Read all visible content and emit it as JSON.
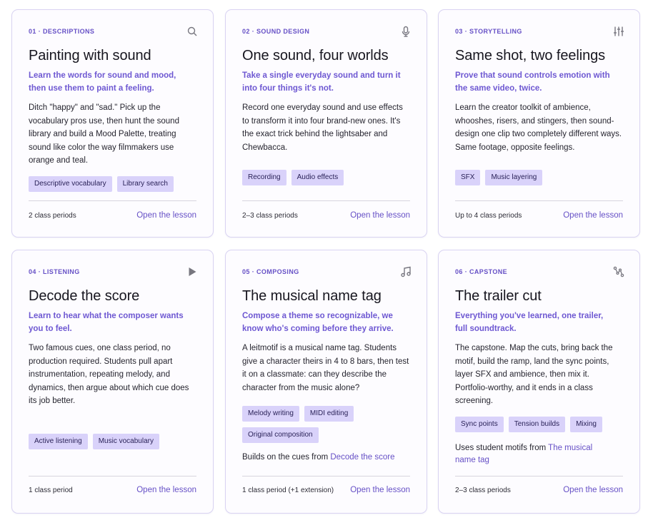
{
  "cards": [
    {
      "eyebrow": "01 · DESCRIPTIONS",
      "icon": "search-icon",
      "title": "Painting with sound",
      "subtitle": "Learn the words for sound and mood, then use them to paint a feeling.",
      "description": "Ditch \"happy\" and \"sad.\" Pick up the vocabulary pros use, then hunt the sound library and build a Mood Palette, treating sound like color the way filmmakers use orange and teal.",
      "tags": [
        "Descriptive vocabulary",
        "Library search"
      ],
      "periods": "2 class periods",
      "link": "Open the lesson"
    },
    {
      "eyebrow": "02 · SOUND DESIGN",
      "icon": "microphone-icon",
      "title": "One sound, four worlds",
      "subtitle": "Take a single everyday sound and turn it into four things it's not.",
      "description": "Record one everyday sound and use effects to transform it into four brand-new ones. It's the exact trick behind the lightsaber and Chewbacca.",
      "tags": [
        "Recording",
        "Audio effects"
      ],
      "periods": "2–3 class periods",
      "link": "Open the lesson"
    },
    {
      "eyebrow": "03 · STORYTELLING",
      "icon": "sliders-icon",
      "title": "Same shot, two feelings",
      "subtitle": "Prove that sound controls emotion with the same video, twice.",
      "description": "Learn the creator toolkit of ambience, whooshes, risers, and stingers, then sound-design one clip two completely different ways. Same footage, opposite feelings.",
      "tags": [
        "SFX",
        "Music layering"
      ],
      "periods": "Up to 4 class periods",
      "link": "Open the lesson"
    },
    {
      "eyebrow": "04 · LISTENING",
      "icon": "play-icon",
      "title": "Decode the score",
      "subtitle": "Learn to hear what the composer wants you to feel.",
      "description": "Two famous cues, one class period, no production required. Students pull apart instrumentation, repeating melody, and dynamics, then argue about which cue does its job better.",
      "tags": [
        "Active listening",
        "Music vocabulary"
      ],
      "periods": "1 class period",
      "link": "Open the lesson"
    },
    {
      "eyebrow": "05 · COMPOSING",
      "icon": "music-note-icon",
      "title": "The musical name tag",
      "subtitle": "Compose a theme so recognizable, we know who's coming before they arrive.",
      "description": "A leitmotif is a musical name tag. Students give a character theirs in 4 to 8 bars, then test it on a classmate: can they describe the character from the music alone?",
      "tags": [
        "Melody writing",
        "MIDI editing",
        "Original composition"
      ],
      "note_prefix": "Builds on the cues from ",
      "note_link": "Decode the score",
      "periods": "1 class period (+1 extension)",
      "link": "Open the lesson"
    },
    {
      "eyebrow": "06 · CAPSTONE",
      "icon": "route-icon",
      "title": "The trailer cut",
      "subtitle": "Everything you've learned, one trailer, full soundtrack.",
      "description": "The capstone. Map the cuts, bring back the motif, build the ramp, land the sync points, layer SFX and ambience, then mix it. Portfolio-worthy, and it ends in a class screening.",
      "tags": [
        "Sync points",
        "Tension builds",
        "Mixing"
      ],
      "note_prefix": "Uses student motifs from ",
      "note_link": "The musical name tag",
      "periods": "2–3 class periods",
      "link": "Open the lesson"
    }
  ],
  "colors": {
    "accent": "#6650c6",
    "tag_bg": "#d9d2fa",
    "border": "#d9d3f2"
  }
}
